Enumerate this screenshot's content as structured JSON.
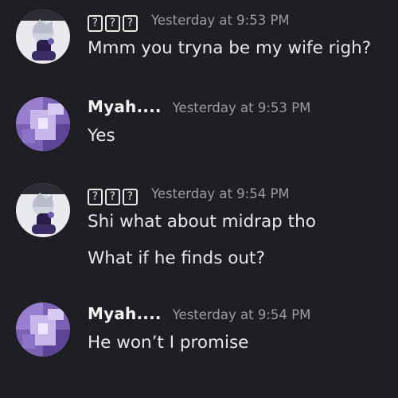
{
  "messages": [
    {
      "username": "???",
      "timestamp": "Yesterday at 9:53 PM",
      "lines": [
        "Mmm you tryna be my wife righ?"
      ]
    },
    {
      "username": "Myah....",
      "timestamp": "Yesterday at 9:53 PM",
      "lines": [
        "Yes"
      ]
    },
    {
      "username": "???",
      "timestamp": "Yesterday at 9:54 PM",
      "lines": [
        "Shi what about midrap tho",
        "What if he finds out?"
      ]
    },
    {
      "username": "Myah....",
      "timestamp": "Yesterday at 9:54 PM",
      "lines": [
        "He won’t I promise"
      ]
    }
  ],
  "colors": {
    "background": "#1e1f22",
    "username": "#f2f3f5",
    "timestamp": "#9b9da3",
    "text": "#e6e7ea"
  }
}
